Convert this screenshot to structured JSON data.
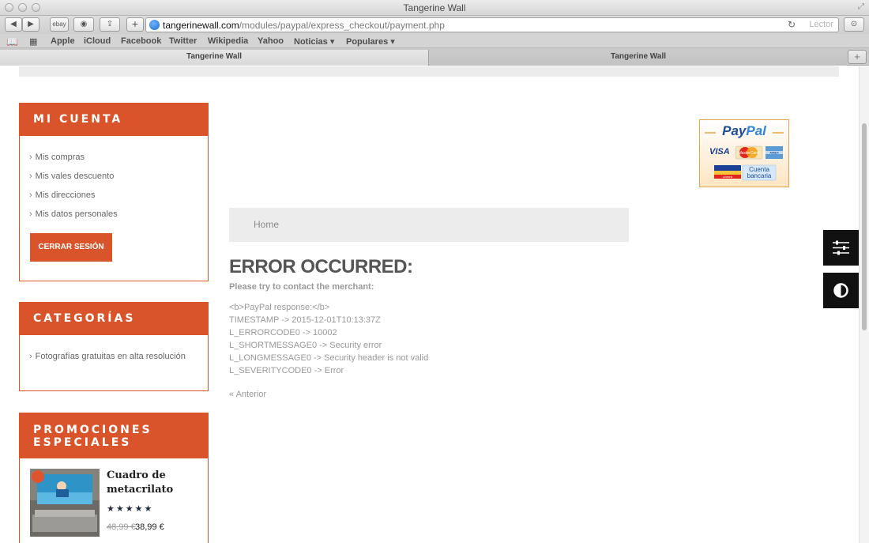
{
  "window": {
    "title": "Tangerine Wall"
  },
  "toolbar": {
    "back_icon": "back-arrow-icon",
    "forward_icon": "forward-arrow-icon",
    "ebay_label": "ebay",
    "url_host": "tangerinewall.com",
    "url_path": "/modules/paypal/express_checkout/payment.php",
    "reader_label": "Lector"
  },
  "bookmarks": {
    "items": [
      "Apple",
      "iCloud",
      "Facebook",
      "Twitter",
      "Wikipedia",
      "Yahoo",
      "Noticias ▾",
      "Populares ▾"
    ]
  },
  "tabs": [
    {
      "label": "Tangerine Wall",
      "active": true
    },
    {
      "label": "Tangerine Wall",
      "active": false
    }
  ],
  "sidebar": {
    "account": {
      "title": "MI CUENTA",
      "items": [
        "Mis compras",
        "Mis vales descuento",
        "Mis direcciones",
        "Mis datos personales"
      ],
      "logout_label": "CERRAR SESIÓN"
    },
    "categories": {
      "title": "CATEGORÍAS",
      "items": [
        "Fotografías gratuitas en alta resolución"
      ]
    },
    "promotions": {
      "title_line1": "PROMOCIONES",
      "title_line2": "ESPECIALES",
      "product": {
        "name_line1": "Cuadro de",
        "name_line2": "metacrilato",
        "rating": 5,
        "price_old": "48,99 €",
        "price_new": "38,99 €"
      }
    }
  },
  "main": {
    "breadcrumb_home": "Home",
    "error_title": "ERROR OCCURRED:",
    "error_subtitle": "Please try to contact the merchant:",
    "response_lines": [
      "<b>PayPal response:</b>",
      "TIMESTAMP -> 2015-12-01T10:13:37Z",
      "L_ERRORCODE0 -> 10002",
      "L_SHORTMESSAGE0 -> Security error",
      "L_LONGMESSAGE0 -> Security header is not valid",
      "L_SEVERITYCODE0 -> Error"
    ],
    "back_link": "« Anterior"
  },
  "paypal_badge": {
    "logo_pay": "Pay",
    "logo_pal": "Pal",
    "visa_label": "VISA",
    "mastercard_label": "MasterCard",
    "amex_label": "AMEX",
    "bank_label_line1": "Cuenta",
    "bank_label_line2": "bancaria",
    "aurora_label": "Aurora"
  },
  "side_buttons": {
    "settings_icon": "sliders-icon",
    "contrast_icon": "contrast-icon"
  },
  "colors": {
    "accent": "#d9542b",
    "dark_button": "#111111",
    "strip": "#ececec"
  }
}
